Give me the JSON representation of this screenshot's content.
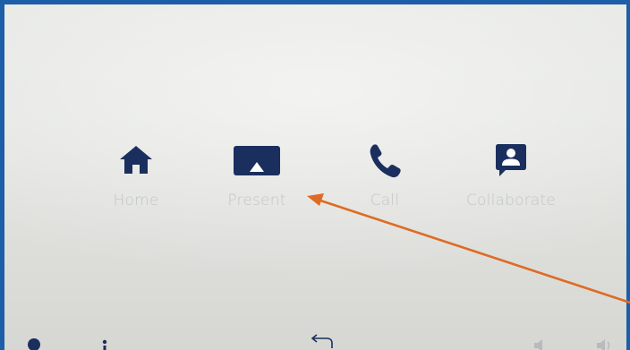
{
  "nav": {
    "items": [
      {
        "id": "home",
        "label": "Home",
        "icon": "home-icon"
      },
      {
        "id": "present",
        "label": "Present",
        "icon": "present-screen-icon"
      },
      {
        "id": "call",
        "label": "Call",
        "icon": "phone-icon"
      },
      {
        "id": "collaborate",
        "label": "Collaborate",
        "icon": "collaborate-icon"
      }
    ]
  },
  "bottom_bar": {
    "icons": [
      "info-icon",
      "more-icon",
      "back-icon",
      "volume-down-icon",
      "volume-up-icon"
    ]
  },
  "annotation": {
    "type": "arrow",
    "color": "#de6b24",
    "points_to": "present"
  },
  "colors": {
    "icon": "#1b2f5e",
    "label": "#c2c4c7",
    "frame": "#1c5ea8",
    "background": "#e4e5e1"
  }
}
